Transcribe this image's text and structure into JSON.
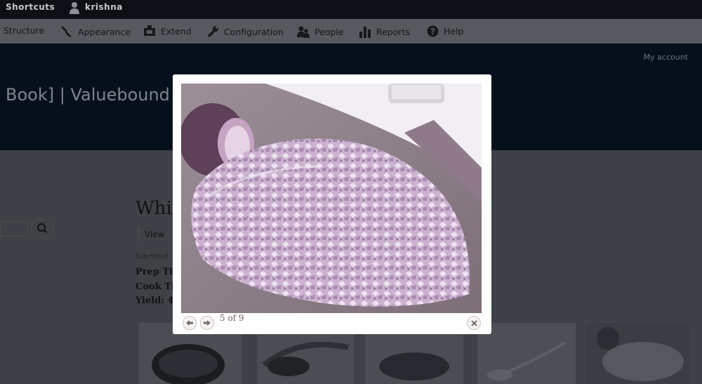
{
  "toolbar": {
    "shortcuts": "Shortcuts",
    "username": "krishna"
  },
  "menu": {
    "items": [
      {
        "label": "Structure",
        "icon": "none"
      },
      {
        "label": "Appearance",
        "icon": "brush-icon"
      },
      {
        "label": "Extend",
        "icon": "puzzle-icon"
      },
      {
        "label": "Configuration",
        "icon": "wrench-icon"
      },
      {
        "label": "People",
        "icon": "people-icon"
      },
      {
        "label": "Reports",
        "icon": "bar-chart-icon"
      },
      {
        "label": "Help",
        "icon": "help-icon"
      }
    ]
  },
  "header": {
    "my_account": "My account",
    "site_title": "Book] | Valuebound"
  },
  "node": {
    "title": "Whi",
    "tab_view": "View",
    "submitted": "Submitted",
    "prep_time": "Prep Ti",
    "cook_time": "Cook Ti",
    "yield": "Yield: 4"
  },
  "lightbox": {
    "counter": "5 of 9",
    "current_index": 5,
    "total": 9
  },
  "colors": {
    "overlay": "#06101c",
    "lightbox_bg": "#fefefe",
    "onion": "#c9aecb"
  }
}
